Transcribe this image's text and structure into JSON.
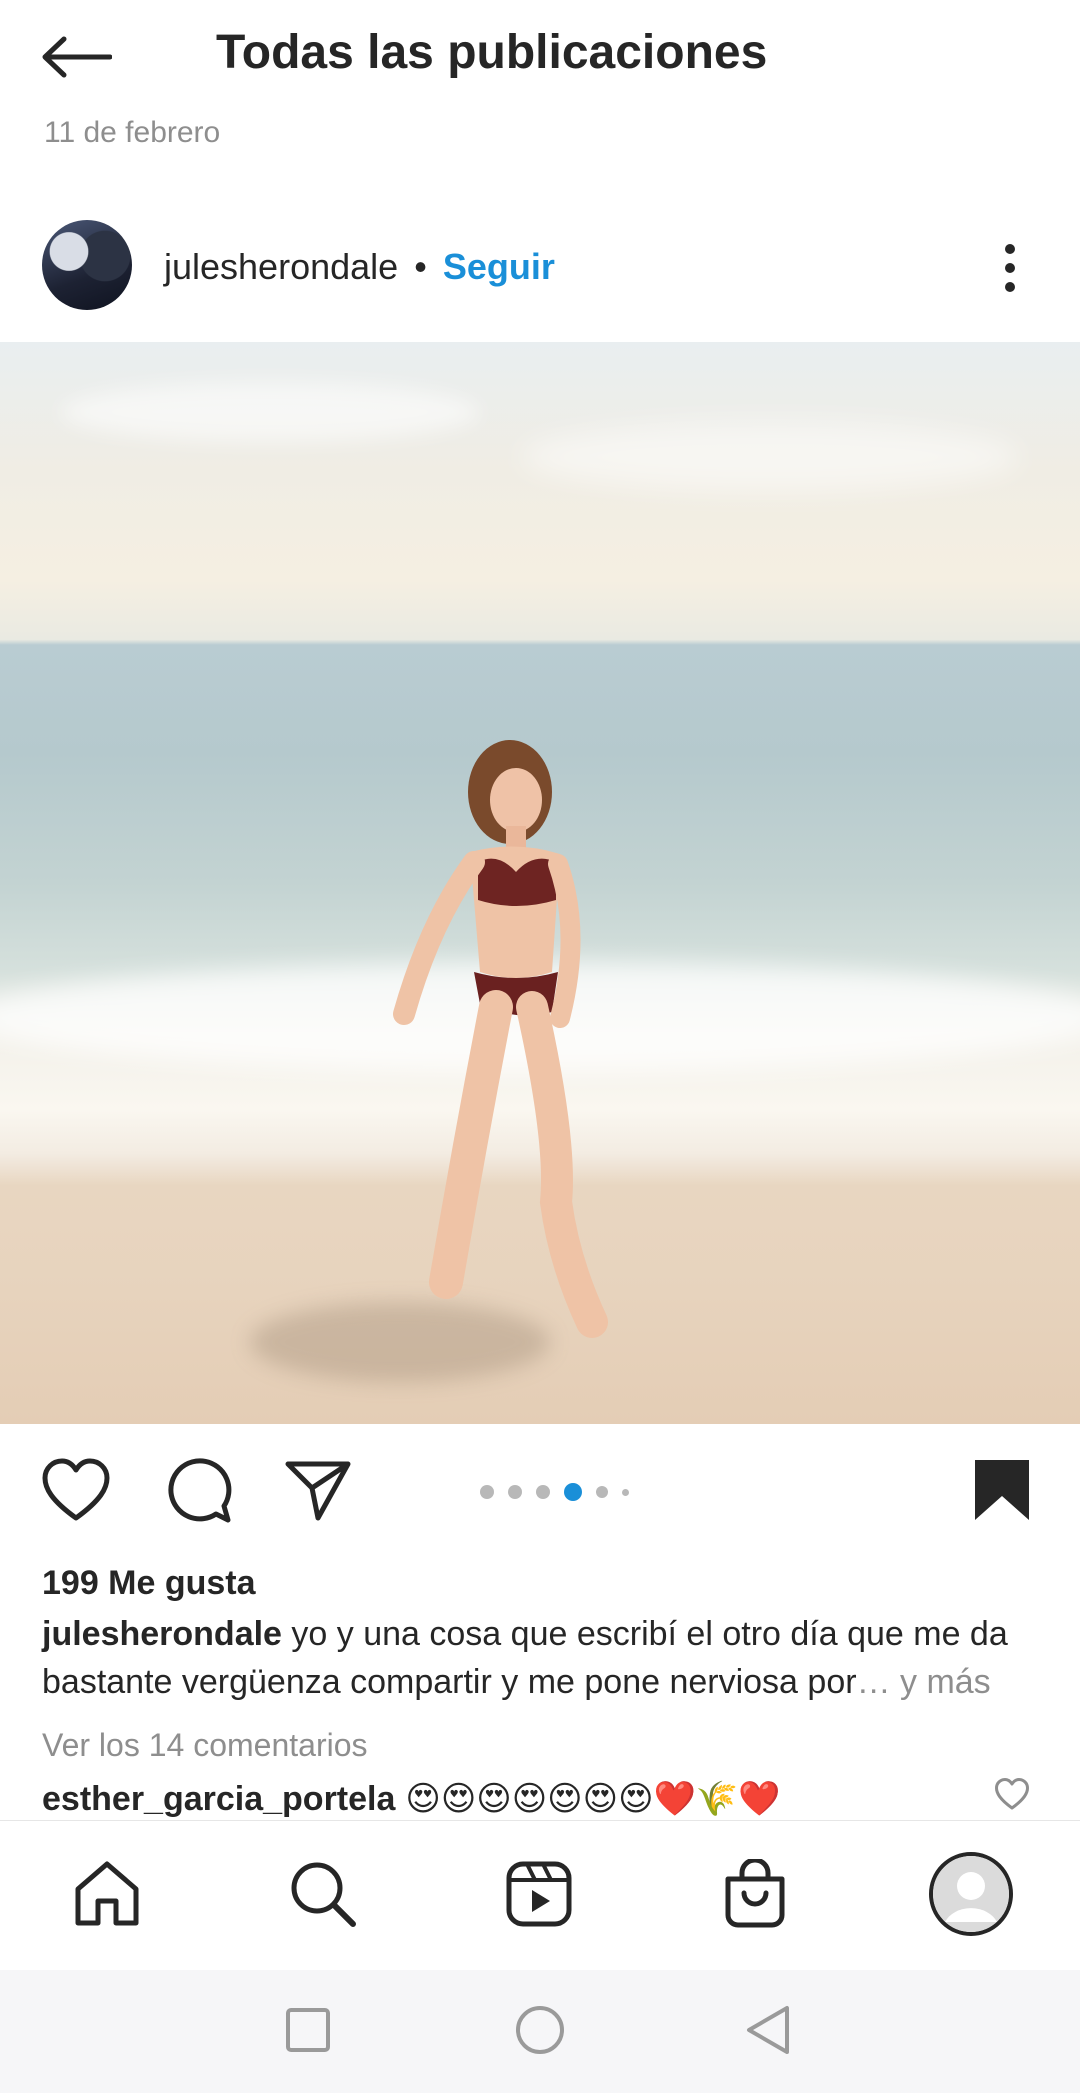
{
  "header": {
    "title": "Todas las publicaciones",
    "back_icon": "arrow-left-icon",
    "previous_post_date": "11 de febrero"
  },
  "post": {
    "username": "julesherondale",
    "separator": "•",
    "follow_label": "Seguir",
    "photo_description_icon": "beach-photo",
    "carousel": {
      "total": 6,
      "active_index": 3
    },
    "likes": "199 Me gusta",
    "caption": {
      "username": "julesherondale",
      "text": "yo y una cosa que escribí el otro día que me da bastante vergüenza compartir y me pone nerviosa por",
      "ellipsis": "…",
      "more": " y más"
    },
    "view_comments": "Ver los 14 comentarios",
    "top_comment": {
      "username": "esther_garcia_portela",
      "text": "😍😍😍😍😍😍😍❤️🌾❤️"
    }
  },
  "nav": {
    "items": [
      "home-icon",
      "search-icon",
      "reels-icon",
      "shop-icon",
      "profile-icon"
    ]
  },
  "colors": {
    "accent": "#1a8fd8",
    "text": "#262626",
    "muted": "#8e8e8e",
    "active_dot": "#1a8fd8"
  }
}
